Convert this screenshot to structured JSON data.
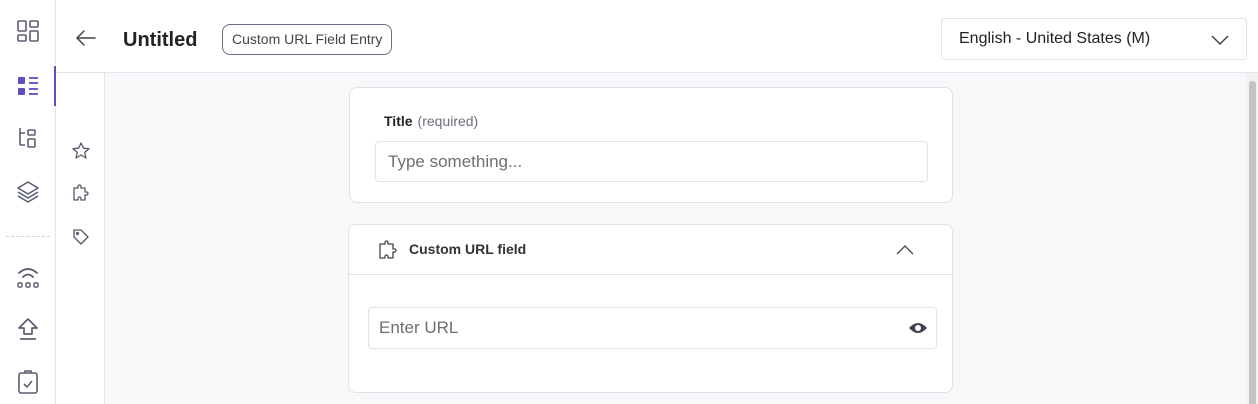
{
  "header": {
    "title": "Untitled",
    "content_type_badge": "Custom URL Field Entry",
    "locale": "English - United States (M)"
  },
  "left_rail": {
    "items": [
      {
        "icon": "dashboard-icon"
      },
      {
        "icon": "entries-icon",
        "active": true
      },
      {
        "icon": "content-models-icon"
      },
      {
        "icon": "assets-icon"
      },
      {
        "icon": "releases-icon"
      },
      {
        "icon": "publish-queue-icon"
      },
      {
        "icon": "tasks-icon"
      }
    ]
  },
  "side_panel": {
    "items": [
      {
        "icon": "star-icon"
      },
      {
        "icon": "extension-icon"
      },
      {
        "icon": "tag-icon"
      }
    ]
  },
  "fields": {
    "title": {
      "label": "Title",
      "required_label": "(required)",
      "placeholder": "Type something...",
      "value": ""
    },
    "custom_url": {
      "label": "Custom URL field",
      "placeholder": "Enter URL",
      "value": ""
    }
  },
  "colors": {
    "accent": "#5d50be",
    "border": "#dfe1e7",
    "canvas": "#f7f8fa"
  }
}
